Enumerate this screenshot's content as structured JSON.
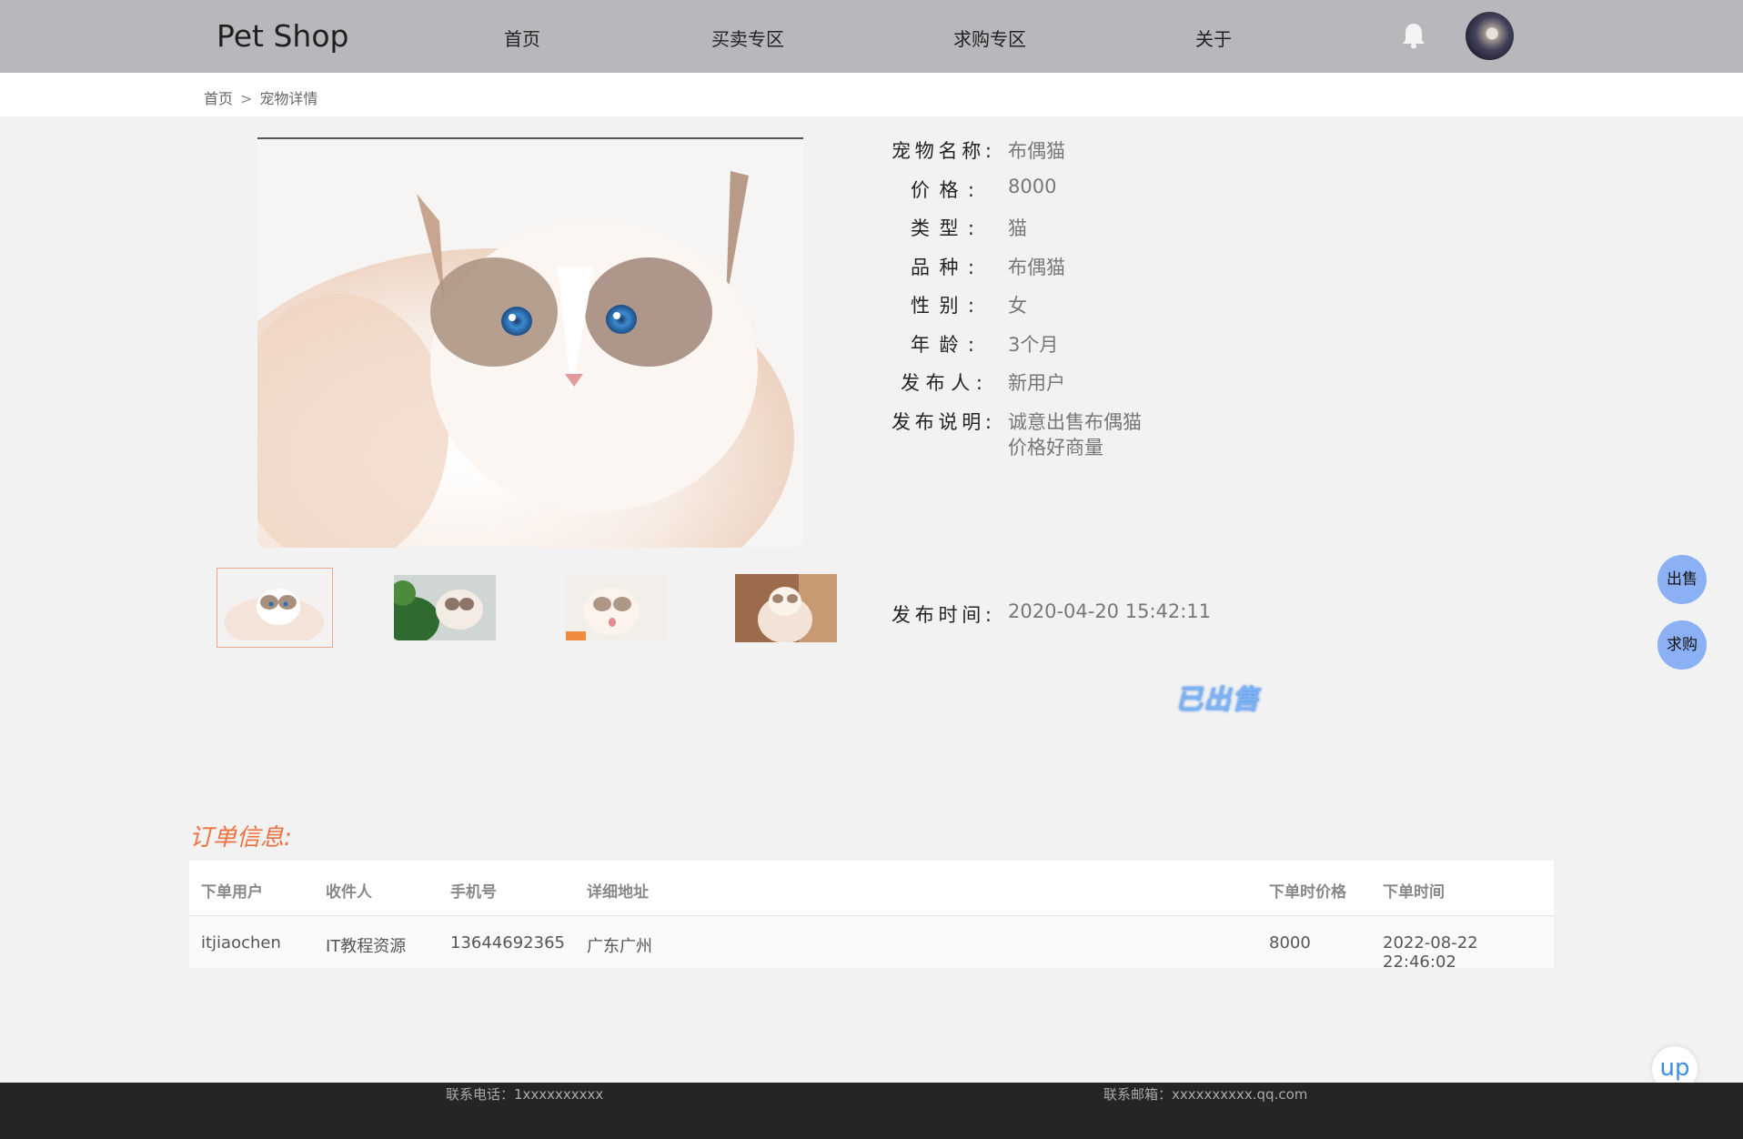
{
  "header": {
    "logo": "Pet Shop",
    "nav": [
      "首页",
      "买卖专区",
      "求购专区",
      "关于"
    ],
    "bell_icon": "bell-icon",
    "avatar": "user-avatar"
  },
  "breadcrumb": {
    "home": "首页",
    "separator": ">",
    "current": "宠物详情"
  },
  "pet": {
    "name_label": "宠物名称:",
    "name": "布偶猫",
    "price_label": "价格:",
    "price": "8000",
    "type_label": "类型:",
    "type": "猫",
    "breed_label": "品种:",
    "breed": "布偶猫",
    "gender_label": "性别:",
    "gender": "女",
    "age_label": "年龄:",
    "age": "3个月",
    "publisher_label": "发布人:",
    "publisher": "新用户",
    "desc_label": "发布说明:",
    "desc_line1": "诚意出售布偶猫",
    "desc_line2": "价格好商量",
    "time_label": "发布时间:",
    "time": "2020-04-20 15:42:11",
    "status": "已出售"
  },
  "float_buttons": {
    "sell": "出售",
    "buy": "求购",
    "up": "up"
  },
  "order": {
    "title": "订单信息:",
    "columns": [
      "下单用户",
      "收件人",
      "手机号",
      "详细地址",
      "下单时价格",
      "下单时间"
    ],
    "rows": [
      [
        "itjiaochen",
        "IT教程资源",
        "13644692365",
        "广东广州",
        "8000",
        "2022-08-22 22:46:02"
      ]
    ]
  },
  "footer": {
    "phone": "联系电话：1xxxxxxxxxx",
    "email": "联系邮箱：xxxxxxxxxx.qq.com"
  },
  "colors": {
    "header_bg": "#b8b7bb",
    "accent_orange": "#f0703f",
    "accent_blue": "#8bb1f4",
    "sold_blue": "#7fb2f2"
  }
}
